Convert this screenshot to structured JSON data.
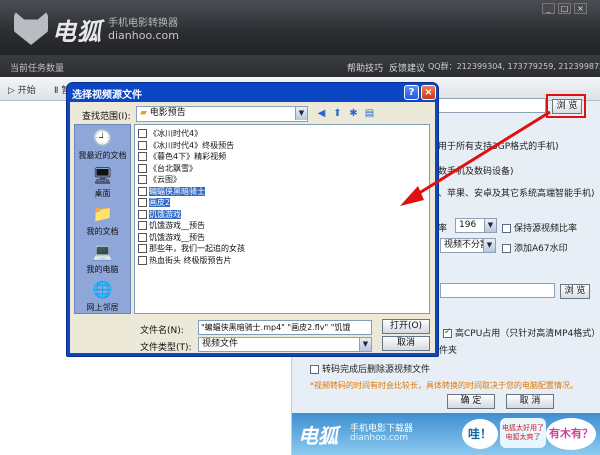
{
  "app": {
    "logo_text": "电狐",
    "logo_sub": "手机电影转换器",
    "logo_url": "dianhoo.com",
    "win_buttons": [
      "_",
      "□",
      "×"
    ]
  },
  "infobar": {
    "task_count": "当前任务数量",
    "help": "帮助技巧",
    "feedback": "反馈建议",
    "qq": "QQ群：212399304, 173779259, 212399872"
  },
  "toolbar": {
    "start": "▷ 开始",
    "pause": "Ⅱ 暂"
  },
  "right_panel": {
    "browse": "浏 览",
    "line1": "用于所有支持3GP格式的手机)",
    "line2": "数手机及数码设备)",
    "line3": "、苹果、安卓及其它系统高端智能手机)",
    "bitrate_label": "率",
    "bitrate_value": "196",
    "keep_ratio": "保持源视频比率",
    "split_value": "视频不分割",
    "watermark": "添加A67水印",
    "browse2": "浏 览",
    "cpu_label": "高CPU占用（只针对高清MP4格式）",
    "folder_tail": "件夹",
    "delete_after": "转码完成后删除源视频文件",
    "note": "*视频转码的时间有时会比较长，具体转换的时间取决于您的电脑配置情况。",
    "ok": "确 定",
    "cancel": "取 消"
  },
  "banner": {
    "logo": "电狐",
    "sub": "手机电影下载器",
    "url": "dianhoo.com",
    "wa": "哇！",
    "mid1": "电狐太好用了",
    "mid2": "电狐太爽了",
    "ask": "有木有？"
  },
  "dialog": {
    "title": "选择视频源文件",
    "help": "?",
    "close": "×",
    "lookin_label": "查找范围(I):",
    "lookin_value": "电影预告",
    "places": [
      "我最近的文档",
      "桌面",
      "我的文档",
      "我的电脑",
      "网上邻居"
    ],
    "files": [
      {
        "name": "《冰川时代4》",
        "selected": false
      },
      {
        "name": "《冰川时代4》终极预告",
        "selected": false
      },
      {
        "name": "《暮色4下》精彩视频",
        "selected": false
      },
      {
        "name": "《台北飘雪》",
        "selected": false
      },
      {
        "name": "《云图》",
        "selected": false
      },
      {
        "name": "蝙蝠侠黑暗骑士",
        "selected": true
      },
      {
        "name": "画皮2",
        "selected": true
      },
      {
        "name": "饥饿游戏",
        "selected": true
      },
      {
        "name": "饥饿游戏__预告",
        "selected": false
      },
      {
        "name": "饥饿游戏__预告",
        "selected": false
      },
      {
        "name": "那些年，我们一起追的女孩",
        "selected": false
      },
      {
        "name": "热血街头 终极版预告片",
        "selected": false
      }
    ],
    "filename_label": "文件名(N):",
    "filename_value": "\"蝙蝠侠黑暗骑士.mp4\" \"画皮2.flv\" \"饥饿",
    "filetype_label": "文件类型(T):",
    "filetype_value": "视频文件",
    "open": "打开(O)",
    "cancel": "取消"
  },
  "colors": {
    "highlight_red": "#e01010",
    "dialog_blue": "#0b47c4",
    "selection": "#316ac5"
  }
}
